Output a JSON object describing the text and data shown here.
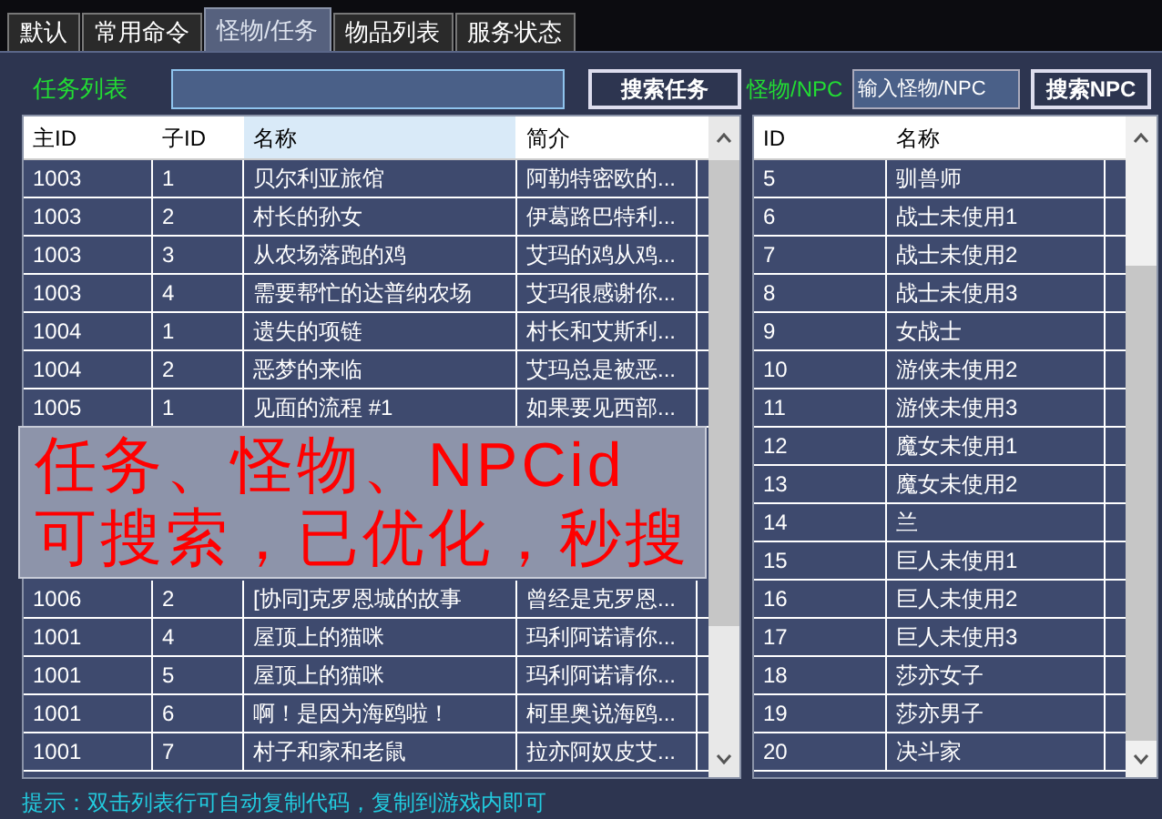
{
  "tabs": [
    {
      "label": "默认",
      "selected": false
    },
    {
      "label": "常用命令",
      "selected": false
    },
    {
      "label": "怪物/任务",
      "selected": true
    },
    {
      "label": "物品列表",
      "selected": false
    },
    {
      "label": "服务状态",
      "selected": false
    }
  ],
  "task_search": {
    "label": "任务列表",
    "button": "搜索任务"
  },
  "npc_search": {
    "label": "怪物/NPC",
    "placeholder": "输入怪物/NPC",
    "button": "搜索NPC"
  },
  "task_table": {
    "columns": [
      {
        "label": "主ID",
        "selected": false
      },
      {
        "label": "子ID",
        "selected": false
      },
      {
        "label": "名称",
        "selected": true
      },
      {
        "label": "简介",
        "selected": false
      }
    ],
    "rows": [
      [
        "1003",
        "1",
        "贝尔利亚旅馆",
        "阿勒特密欧的..."
      ],
      [
        "1003",
        "2",
        "村长的孙女",
        "伊葛路巴特利..."
      ],
      [
        "1003",
        "3",
        "从农场落跑的鸡",
        "艾玛的鸡从鸡..."
      ],
      [
        "1003",
        "4",
        "需要帮忙的达普纳农场",
        "艾玛很感谢你..."
      ],
      [
        "1004",
        "1",
        "遗失的项链",
        "村长和艾斯利..."
      ],
      [
        "1004",
        "2",
        "恶梦的来临",
        "艾玛总是被恶..."
      ],
      [
        "1005",
        "1",
        "见面的流程 #1",
        "如果要见西部..."
      ],
      [
        "1006",
        "2",
        "[协同]克罗恩城的故事",
        "曾经是克罗恩..."
      ],
      [
        "1001",
        "4",
        "屋顶上的猫咪",
        "玛利阿诺请你..."
      ],
      [
        "1001",
        "5",
        "屋顶上的猫咪",
        "玛利阿诺请你..."
      ],
      [
        "1001",
        "6",
        "啊！是因为海鸥啦！",
        "柯里奥说海鸥..."
      ],
      [
        "1001",
        "7",
        "村子和家和老鼠",
        "拉亦阿奴皮艾..."
      ]
    ]
  },
  "npc_table": {
    "columns": [
      {
        "label": "ID"
      },
      {
        "label": "名称"
      }
    ],
    "rows": [
      [
        "5",
        "驯兽师"
      ],
      [
        "6",
        "战士未使用1"
      ],
      [
        "7",
        "战士未使用2"
      ],
      [
        "8",
        "战士未使用3"
      ],
      [
        "9",
        "女战士"
      ],
      [
        "10",
        "游侠未使用2"
      ],
      [
        "11",
        "游侠未使用3"
      ],
      [
        "12",
        "魔女未使用1"
      ],
      [
        "13",
        "魔女未使用2"
      ],
      [
        "14",
        "兰"
      ],
      [
        "15",
        "巨人未使用1"
      ],
      [
        "16",
        "巨人未使用2"
      ],
      [
        "17",
        "巨人未使用3"
      ],
      [
        "18",
        "莎亦女子"
      ],
      [
        "19",
        "莎亦男子"
      ],
      [
        "20",
        "决斗家"
      ]
    ]
  },
  "overlay": {
    "lines": [
      "任务、怪物、NPCid",
      "可搜索，已优化，秒搜"
    ]
  },
  "hint": "提示：双击列表行可自动复制代码，复制到游戏内即可"
}
